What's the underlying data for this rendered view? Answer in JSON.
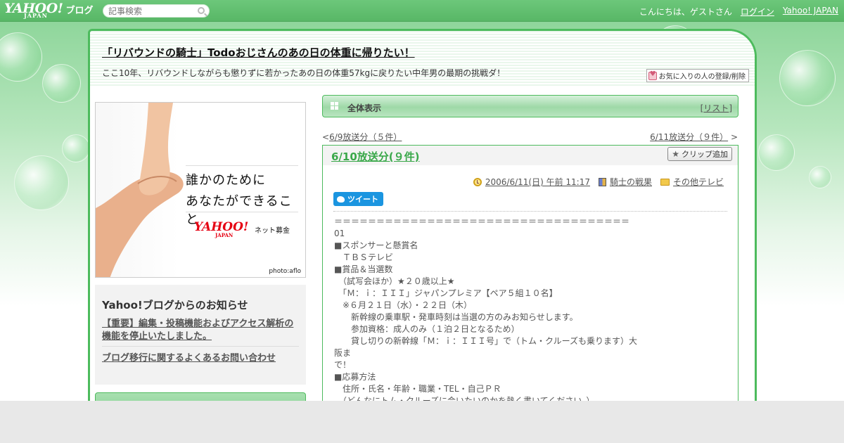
{
  "topbar": {
    "logo_main": "YAHOO!",
    "logo_sub": "JAPAN",
    "logo_blog": "ブログ",
    "search_placeholder": "記事検索",
    "greeting": "こんにちは、ゲストさん",
    "login": "ログイン",
    "yahoo_japan": "Yahoo! JAPAN"
  },
  "header": {
    "blog_title": "「リバウンドの騎士」Todoおじさんのあの日の体重に帰りたい！",
    "blog_desc": "ここ10年、リバウンドしながらも懲りずに若かったあの日の体重57kgに戻りたい中年男の最期の挑戦ダ！",
    "fav_button": "お気に入りの人の登録/削除"
  },
  "sidebar": {
    "banner": {
      "line1": "誰かのために",
      "line2": "あなたができること",
      "logo_main": "YAHOO!",
      "logo_sub": "JAPAN",
      "bokin": "ネット募金",
      "credit": "photo:aflo"
    },
    "notice": {
      "title": "Yahoo!ブログからのお知らせ",
      "items": [
        "【重要】編集・投稿機能およびアクセス解析の機能を停止いたしました。",
        "ブログ移行に関するよくあるお問い合わせ"
      ]
    }
  },
  "main": {
    "viewbar": {
      "label": "全体表示",
      "list_open": "[",
      "list_label": "リスト",
      "list_close": "]"
    },
    "pager": {
      "prev_mark": "<",
      "prev": "6/9放送分（５件）",
      "next": "6/11放送分（９件）",
      "next_mark": ">"
    },
    "article": {
      "title": "6/10放送分(９件)",
      "clip_button": "クリップ追加",
      "date": "2006/6/11(日) 午前 11:17",
      "category": "騎士の戦果",
      "folder": "その他テレビ",
      "tweet": "ツイート",
      "lines": [
        "＝＝＝＝＝＝＝＝＝＝＝＝＝＝＝＝＝＝＝＝＝＝＝＝＝＝＝＝＝＝＝＝＝＝＝",
        "01",
        "■スポンサーと懸賞名",
        "　ＴＢＳテレビ",
        "■賞品＆当選数",
        "　（試写会ほか）★２０歳以上★",
        "　「Ｍ：ｉ：ＩＩＩ」ジャパンプレミア【ペア５組１０名】",
        "　※６月２１日（水）・２２日（木）",
        "　　新幹線の乗車駅・発車時刻は当選の方のみお知らせします。",
        "　　参加資格：成人のみ（１泊２日となるため）",
        "　　貸し切りの新幹線「Ｍ：ｉ：ＩＩＩ号」で（トム・クルーズも乗ります）大",
        "阪ま",
        "で！",
        "■応募方法",
        "　住所・氏名・年齢・職業・TEL・自己ＰＲ",
        "　（どんなにトム・クルーズに会いたいのかを熱く書いてください。）"
      ]
    }
  },
  "colors": {
    "topbar": "#5fbf6d",
    "frame_border": "#4dbb5d",
    "article_title": "#3aa84a",
    "tweet": "#1b95e0"
  }
}
